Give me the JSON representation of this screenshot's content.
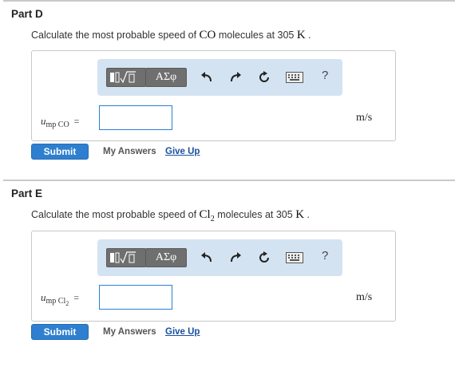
{
  "parts": [
    {
      "title": "Part D",
      "question_before": "Calculate the most probable speed of ",
      "molecule_main": "CO",
      "molecule_sub": "",
      "question_middle": " molecules at ",
      "temperature": "305",
      "temperature_unit": "K",
      "question_end": " .",
      "var_symbol": "u",
      "var_subscript_main": "mp CO",
      "var_subscript_small": "",
      "equals": "=",
      "answer_value": "",
      "unit": "m/s",
      "submit_label": "Submit",
      "my_answers_label": "My Answers",
      "give_up_label": "Give Up"
    },
    {
      "title": "Part E",
      "question_before": "Calculate the most probable speed of ",
      "molecule_main": "Cl",
      "molecule_sub": "2",
      "question_middle": " molecules at ",
      "temperature": "305",
      "temperature_unit": "K",
      "question_end": " .",
      "var_symbol": "u",
      "var_subscript_main": "mp Cl",
      "var_subscript_small": "2",
      "equals": "=",
      "answer_value": "",
      "unit": "m/s",
      "submit_label": "Submit",
      "my_answers_label": "My Answers",
      "give_up_label": "Give Up"
    }
  ],
  "toolbar": {
    "greek_label": "ΑΣφ",
    "help_label": "?",
    "icons": [
      "templates-icon",
      "undo-icon",
      "redo-icon",
      "reset-icon",
      "keyboard-icon",
      "help-icon"
    ]
  },
  "colors": {
    "toolbar_bg": "#d4e3f2",
    "submit_bg": "#2e7fcf",
    "link": "#1a4f9e",
    "input_border": "#2980d6"
  }
}
